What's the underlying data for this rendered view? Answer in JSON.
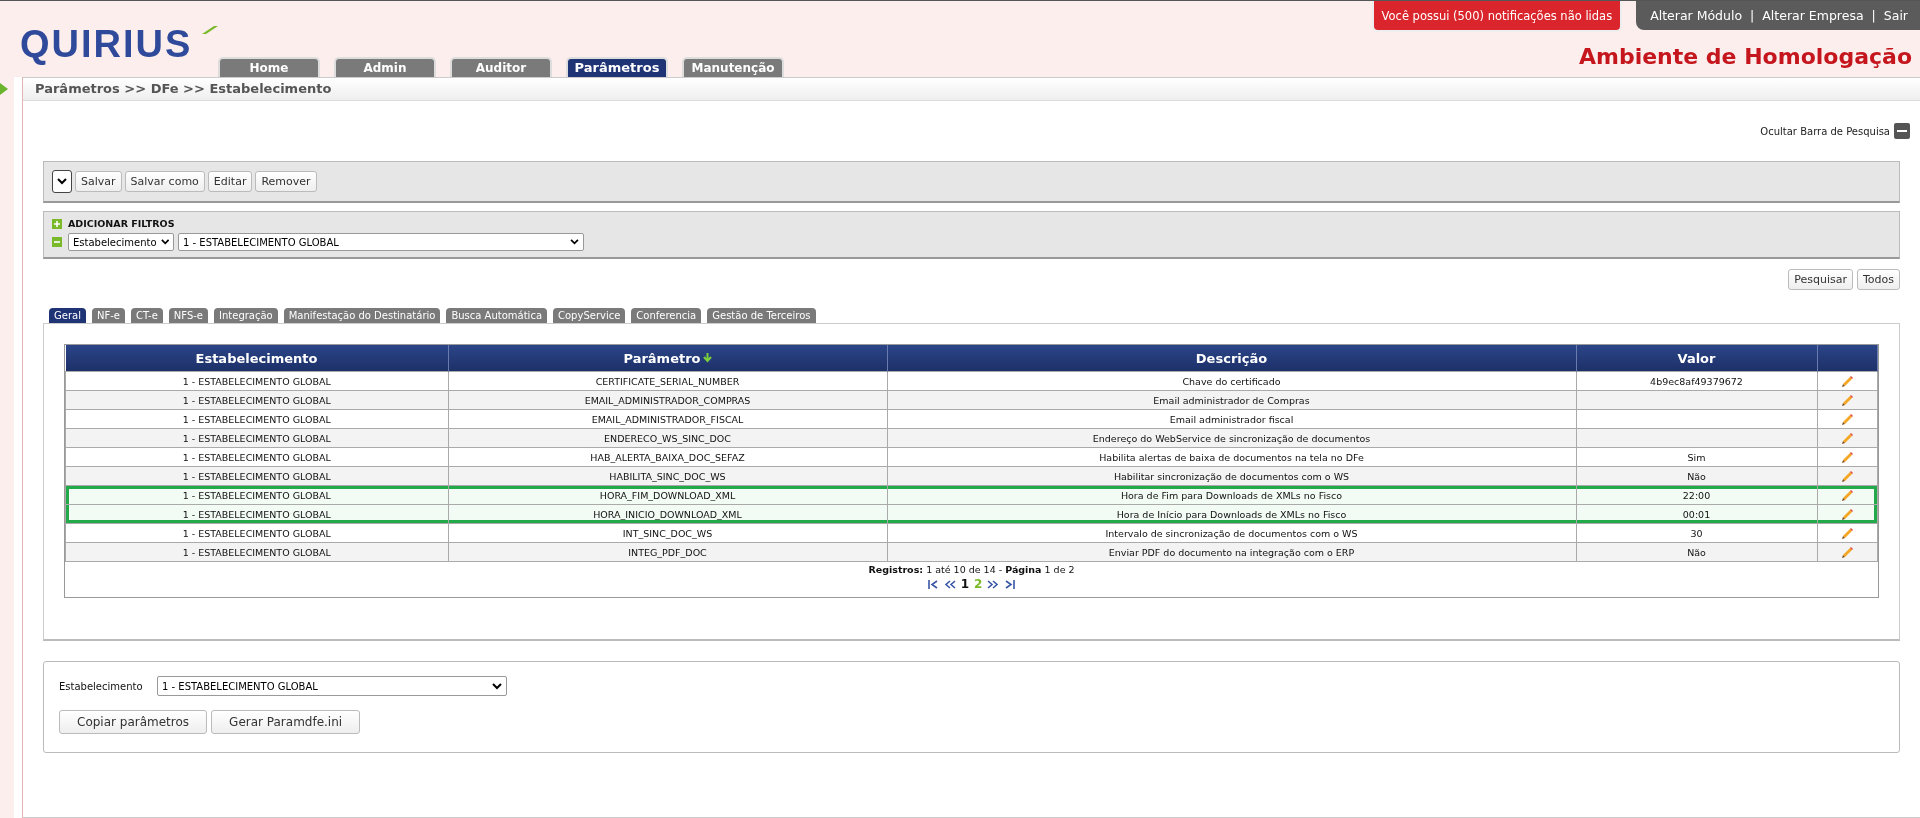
{
  "header": {
    "logo": "QUIRIUS",
    "notification": "Você possui (500) notificações não lidas",
    "top_links": [
      "Alterar Módulo",
      "Alterar Empresa",
      "Sair"
    ],
    "separator": "|",
    "environment": "Ambiente de Homologação"
  },
  "nav_tabs": [
    {
      "label": "Home",
      "selected": false
    },
    {
      "label": "Admin",
      "selected": false
    },
    {
      "label": "Auditor",
      "selected": false
    },
    {
      "label": "Parâmetros",
      "selected": true
    },
    {
      "label": "Manutenção",
      "selected": false
    }
  ],
  "breadcrumb": "Parâmetros >> DFe >> Estabelecimento",
  "hide_search": "Ocultar Barra de Pesquisa",
  "toolbar": [
    "Salvar",
    "Salvar como",
    "Editar",
    "Remover"
  ],
  "filters": {
    "title": "ADICIONAR FILTROS",
    "field": "Estabelecimento",
    "value": "1 - ESTABELECIMENTO GLOBAL"
  },
  "search_buttons": [
    "Pesquisar",
    "Todos"
  ],
  "tabs": [
    {
      "label": "Geral",
      "selected": true
    },
    {
      "label": "NF-e",
      "selected": false
    },
    {
      "label": "CT-e",
      "selected": false
    },
    {
      "label": "NFS-e",
      "selected": false
    },
    {
      "label": "Integração",
      "selected": false
    },
    {
      "label": "Manifestação do Destinatário",
      "selected": false
    },
    {
      "label": "Busca Automática",
      "selected": false
    },
    {
      "label": "CopyService",
      "selected": false
    },
    {
      "label": "Conferencia",
      "selected": false
    },
    {
      "label": "Gestão de Terceiros",
      "selected": false
    }
  ],
  "table": {
    "columns": [
      {
        "label": "Estabelecimento",
        "sorted": false
      },
      {
        "label": "Parâmetro",
        "sorted": true
      },
      {
        "label": "Descrição",
        "sorted": false
      },
      {
        "label": "Valor",
        "sorted": false
      }
    ],
    "rows": [
      {
        "cells": [
          "1 - ESTABELECIMENTO GLOBAL",
          "CERTIFICATE_SERIAL_NUMBER",
          "Chave do certificado",
          "4b9ec8af49379672"
        ],
        "highlighted": false
      },
      {
        "cells": [
          "1 - ESTABELECIMENTO GLOBAL",
          "EMAIL_ADMINISTRADOR_COMPRAS",
          "Email administrador de Compras",
          ""
        ],
        "highlighted": false
      },
      {
        "cells": [
          "1 - ESTABELECIMENTO GLOBAL",
          "EMAIL_ADMINISTRADOR_FISCAL",
          "Email administrador fiscal",
          ""
        ],
        "highlighted": false
      },
      {
        "cells": [
          "1 - ESTABELECIMENTO GLOBAL",
          "ENDERECO_WS_SINC_DOC",
          "Endereço do WebService de sincronização de documentos",
          ""
        ],
        "highlighted": false
      },
      {
        "cells": [
          "1 - ESTABELECIMENTO GLOBAL",
          "HAB_ALERTA_BAIXA_DOC_SEFAZ",
          "Habilita alertas de baixa de documentos na tela no DFe",
          "Sim"
        ],
        "highlighted": false
      },
      {
        "cells": [
          "1 - ESTABELECIMENTO GLOBAL",
          "HABILITA_SINC_DOC_WS",
          "Habilitar sincronização de documentos com o WS",
          "Não"
        ],
        "highlighted": false
      },
      {
        "cells": [
          "1 - ESTABELECIMENTO GLOBAL",
          "HORA_FIM_DOWNLOAD_XML",
          "Hora de Fim para Downloads de XMLs no Fisco",
          "22:00"
        ],
        "highlighted": true
      },
      {
        "cells": [
          "1 - ESTABELECIMENTO GLOBAL",
          "HORA_INICIO_DOWNLOAD_XML",
          "Hora de Início para Downloads de XMLs no Fisco",
          "00:01"
        ],
        "highlighted": true
      },
      {
        "cells": [
          "1 - ESTABELECIMENTO GLOBAL",
          "INT_SINC_DOC_WS",
          "Intervalo de sincronização de documentos com o WS",
          "30"
        ],
        "highlighted": false
      },
      {
        "cells": [
          "1 - ESTABELECIMENTO GLOBAL",
          "INTEG_PDF_DOC",
          "Enviar PDF do documento na integração com o ERP",
          "Não"
        ],
        "highlighted": false
      }
    ],
    "records": "**Registros:** 1 até 10 de 14 - **Página** 1 de 2",
    "pages": [
      {
        "label": "1",
        "selected": true
      },
      {
        "label": "2",
        "selected": false
      }
    ]
  },
  "bottom": {
    "label": "Estabelecimento",
    "value": "1 - ESTABELECIMENTO GLOBAL",
    "buttons": [
      "Copiar parâmetros",
      "Gerar Paramdfe.ini"
    ]
  }
}
